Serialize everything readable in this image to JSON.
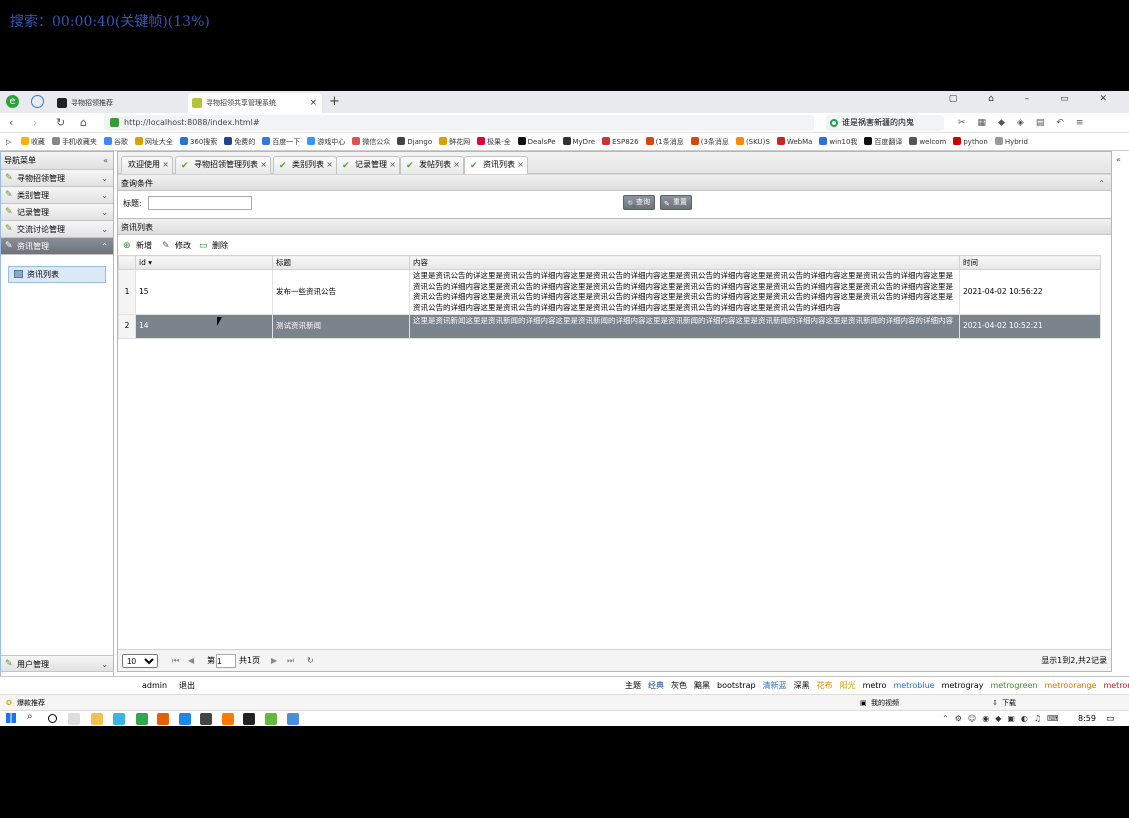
{
  "overlay": {
    "text": "搜索：00:00:40(关键帧)(13%)"
  },
  "browser": {
    "tabs": [
      {
        "label": "寻物招领推荐",
        "active": false
      },
      {
        "label": "寻物招领共享管理系统",
        "active": true
      }
    ],
    "address": "http://localhost:8088/index.html#",
    "search_value": "谁是祸害新疆的内鬼",
    "bookmarks": [
      "收藏",
      "手机收藏夹",
      "谷歌",
      "网址大全",
      "360搜索",
      "免费的",
      "百度一下",
      "游戏中心",
      "微信公众",
      "Django",
      "鲜花网",
      "极果-全",
      "DealsPe",
      "MyDre",
      "ESP826",
      "(1条消息",
      "(3条消息",
      "(SKU)S",
      "WebMa",
      "win10我",
      "百度翻译",
      "welcom",
      "python",
      "Hybrid"
    ]
  },
  "sidebar": {
    "title": "导航菜单",
    "items": [
      {
        "label": "寻物招领管理"
      },
      {
        "label": "类别管理"
      },
      {
        "label": "记录管理"
      },
      {
        "label": "交流讨论管理"
      },
      {
        "label": "资讯管理"
      }
    ],
    "subitem": "资讯列表",
    "bottom_item": "用户管理"
  },
  "main": {
    "tabs": [
      {
        "label": "欢迎使用",
        "check": false
      },
      {
        "label": "寻物招领管理列表",
        "check": true
      },
      {
        "label": "类别列表",
        "check": true
      },
      {
        "label": "记录管理",
        "check": true
      },
      {
        "label": "发帖列表",
        "check": true
      },
      {
        "label": "资讯列表",
        "check": true
      }
    ],
    "query_title": "查询条件",
    "filter_label": "标题:",
    "filter_value": "",
    "search_button": "查询",
    "reset_button": "重置",
    "list_title": "资讯列表",
    "toolbar": {
      "add": "新增",
      "edit": "修改",
      "delete": "删除"
    },
    "columns": [
      "id",
      "标题",
      "内容",
      "时间"
    ],
    "rows": [
      {
        "rn": "1",
        "id": "15",
        "title": "发布一些资讯公告",
        "content": "这里是资讯公告的详这里是资讯公告的详细内容这里是资讯公告的详细内容这里是资讯公告的详细内容这里是资讯公告的详细内容这里是资讯公告的详细内容这里是资讯公告的详细内容这里是资讯公告的详细内容这里是资讯公告的详细内容这里是资讯公告的详细内容这里是资讯公告的详细内容这里是资讯公告的详细内容这里是资讯公告的详细内容这里是资讯公告的详细内容这里是资讯公告的详细内容这里是资讯公告的详细内容这里是资讯公告的详细内容这里是资讯公告的详细内容这里是资讯公告的详细内容这里是资讯公告的详细内容这里是资讯公告的详细内容这里是资讯公告的详细内容这里是资讯公告的详细内容",
        "time": "2021-04-02 10:56:22",
        "selected": false
      },
      {
        "rn": "2",
        "id": "14",
        "title": "测试资讯新闻",
        "content": "这里是资讯新闻这里是资讯新闻的详细内容这里是资讯新闻的详细内容这里是资讯新闻的详细内容这里是资讯新闻的详细内容这里是资讯新闻的详细内容的详细内容",
        "time": "2021-04-02 10:52:21",
        "selected": true
      }
    ],
    "pager": {
      "page_size": "10",
      "page_prefix": "第",
      "page": "1",
      "page_total": "共1页",
      "summary": "显示1到2,共2记录"
    }
  },
  "footer": {
    "user": "admin",
    "logout": "退出",
    "themes": [
      "主题",
      "经典",
      "灰色",
      "黯黑",
      "bootstrap",
      "清新蓝",
      "深黑",
      "花布",
      "阳光",
      "metro",
      "metroblue",
      "metrogray",
      "metrogreen",
      "metroorange",
      "metrored"
    ]
  },
  "browser_status": {
    "left": "爆款推荐",
    "right": [
      "我的视频",
      "下载"
    ]
  },
  "taskbar": {
    "time": "8:59"
  }
}
